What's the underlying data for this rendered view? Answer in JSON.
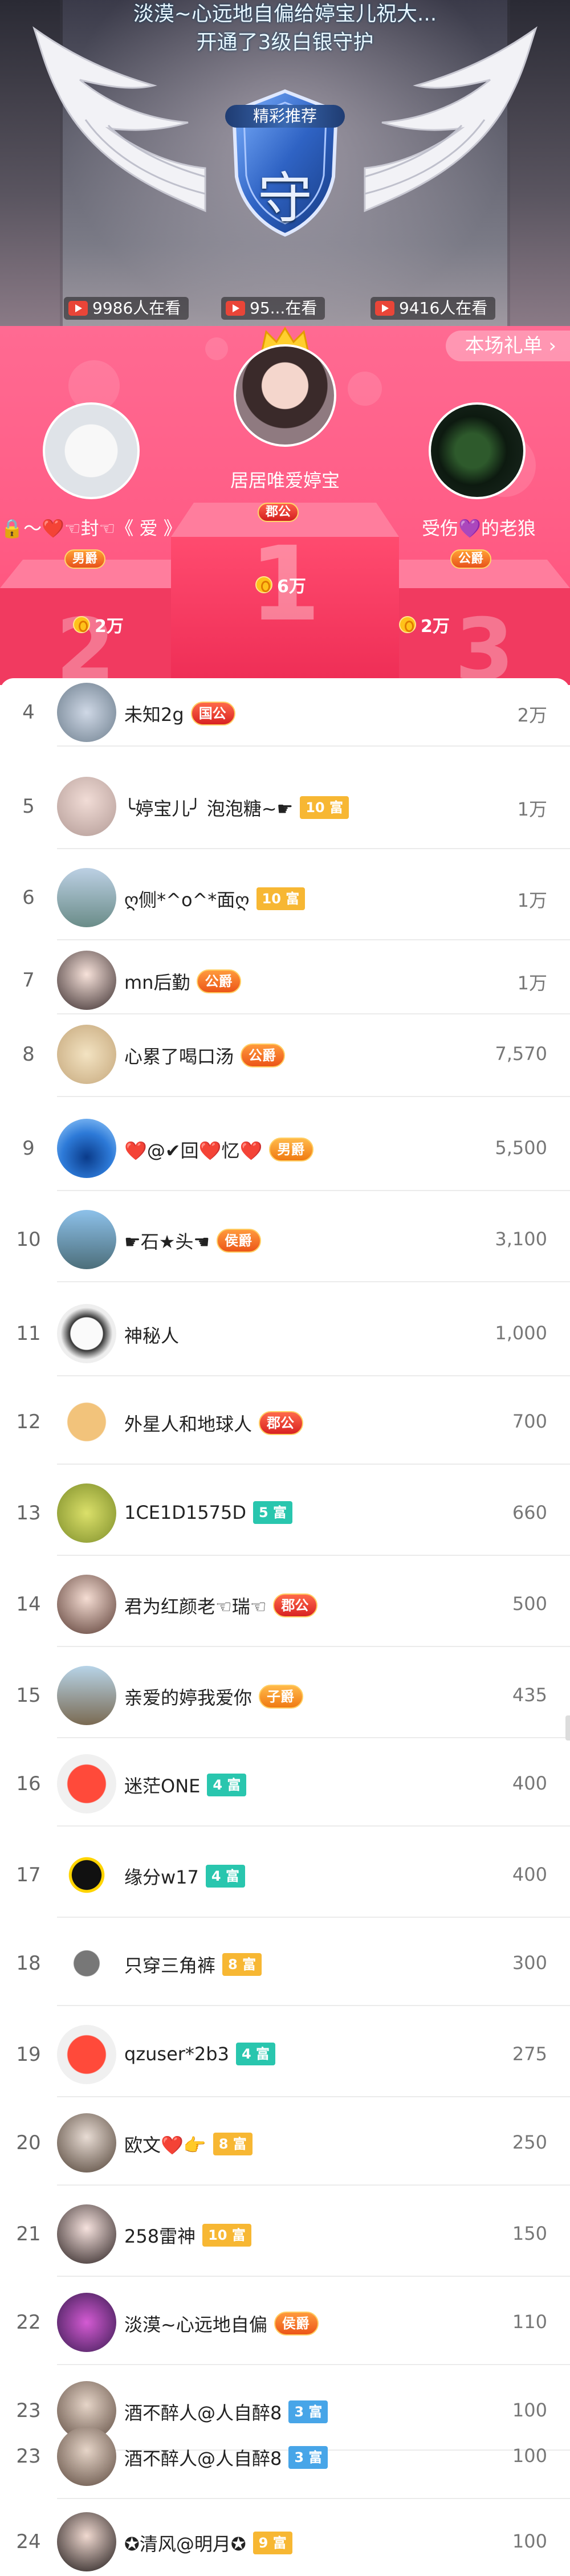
{
  "banner": {
    "gift_line1": "淡漠~心远地自偏给婷宝儿祝大...",
    "gift_line2": "开通了3级白银守护",
    "shield_label": "精彩推荐",
    "shield_char": "守",
    "viewers": [
      "9986人在看",
      "95...在看",
      "9416人在看"
    ]
  },
  "gift_list_button": "本场礼单 ›",
  "top3": [
    {
      "rank": 1,
      "name": "居居唯爱婷宝",
      "badge": "郡公",
      "score": "6万"
    },
    {
      "rank": 2,
      "name": "🔒～❤️☜封☜《 爱 》",
      "badge": "男爵",
      "score": "2万"
    },
    {
      "rank": 3,
      "name": "受伤💜的老狼",
      "badge": "公爵",
      "score": "2万"
    }
  ],
  "podium_numbers": [
    "1",
    "2",
    "3"
  ],
  "list": [
    {
      "rank": "4",
      "name": "未知2g",
      "tag": "国公",
      "tag_type": "red",
      "score": "2万"
    },
    {
      "rank": "5",
      "name": "╰婷宝儿╯ 泡泡糖~☛",
      "tag": "10 富",
      "tag_type": "yellow",
      "score": "1万"
    },
    {
      "rank": "6",
      "name": "ღ侧*^o^*面ღ",
      "tag": "10 富",
      "tag_type": "yellow",
      "score": "1万"
    },
    {
      "rank": "7",
      "name": "mn后勤",
      "tag": "公爵",
      "tag_type": "orange",
      "score": "1万"
    },
    {
      "rank": "8",
      "name": "心累了喝口汤",
      "tag": "公爵",
      "tag_type": "orange",
      "score": "7,570"
    },
    {
      "rank": "9",
      "name": "❤️@✔回❤️忆❤️",
      "tag": "男爵",
      "tag_type": "gold",
      "score": "5,500"
    },
    {
      "rank": "10",
      "name": "☛石★头☚",
      "tag": "侯爵",
      "tag_type": "orange",
      "score": "3,100"
    },
    {
      "rank": "11",
      "name": "神秘人",
      "tag": "",
      "tag_type": "",
      "score": "1,000"
    },
    {
      "rank": "12",
      "name": "外星人和地球人",
      "tag": "郡公",
      "tag_type": "red",
      "score": "700"
    },
    {
      "rank": "13",
      "name": "1CE1D1575D",
      "tag": "5 富",
      "tag_type": "teal",
      "score": "660"
    },
    {
      "rank": "14",
      "name": "君为红颜老☜瑞☜",
      "tag": "郡公",
      "tag_type": "red",
      "score": "500"
    },
    {
      "rank": "15",
      "name": "亲爱的婷我爱你",
      "tag": "子爵",
      "tag_type": "gold",
      "score": "435"
    },
    {
      "rank": "16",
      "name": "迷茫ONE",
      "tag": "4 富",
      "tag_type": "teal",
      "score": "400"
    },
    {
      "rank": "17",
      "name": "缘分w17",
      "tag": "4 富",
      "tag_type": "teal",
      "score": "400"
    },
    {
      "rank": "18",
      "name": "只穿三角裤",
      "tag": "8 富",
      "tag_type": "yellow",
      "score": "300"
    },
    {
      "rank": "19",
      "name": "qzuser*2b3",
      "tag": "4 富",
      "tag_type": "teal",
      "score": "275"
    },
    {
      "rank": "20",
      "name": "欧文❤️👉",
      "tag": "8 富",
      "tag_type": "yellow",
      "score": "250"
    },
    {
      "rank": "21",
      "name": "258雷神",
      "tag": "10 富",
      "tag_type": "yellow",
      "score": "150"
    },
    {
      "rank": "22",
      "name": "淡漠~心远地自偏",
      "tag": "侯爵",
      "tag_type": "orange",
      "score": "110"
    },
    {
      "rank": "23",
      "name": "酒不醉人@人自醉8",
      "tag": "3 富",
      "tag_type": "blue",
      "score": "100"
    },
    {
      "rank": "23",
      "name": "酒不醉人@人自醉8",
      "tag": "3 富",
      "tag_type": "blue",
      "score": "100"
    },
    {
      "rank": "24",
      "name": "✪清风@明月✪",
      "tag": "9 富",
      "tag_type": "yellow",
      "score": "100"
    }
  ],
  "colors": {
    "pink": "#ff5d86",
    "rich_yellow": "#f7b733",
    "rich_teal": "#29c6ae",
    "rich_blue": "#47a5e8",
    "noble_orange": "#ec5518"
  }
}
